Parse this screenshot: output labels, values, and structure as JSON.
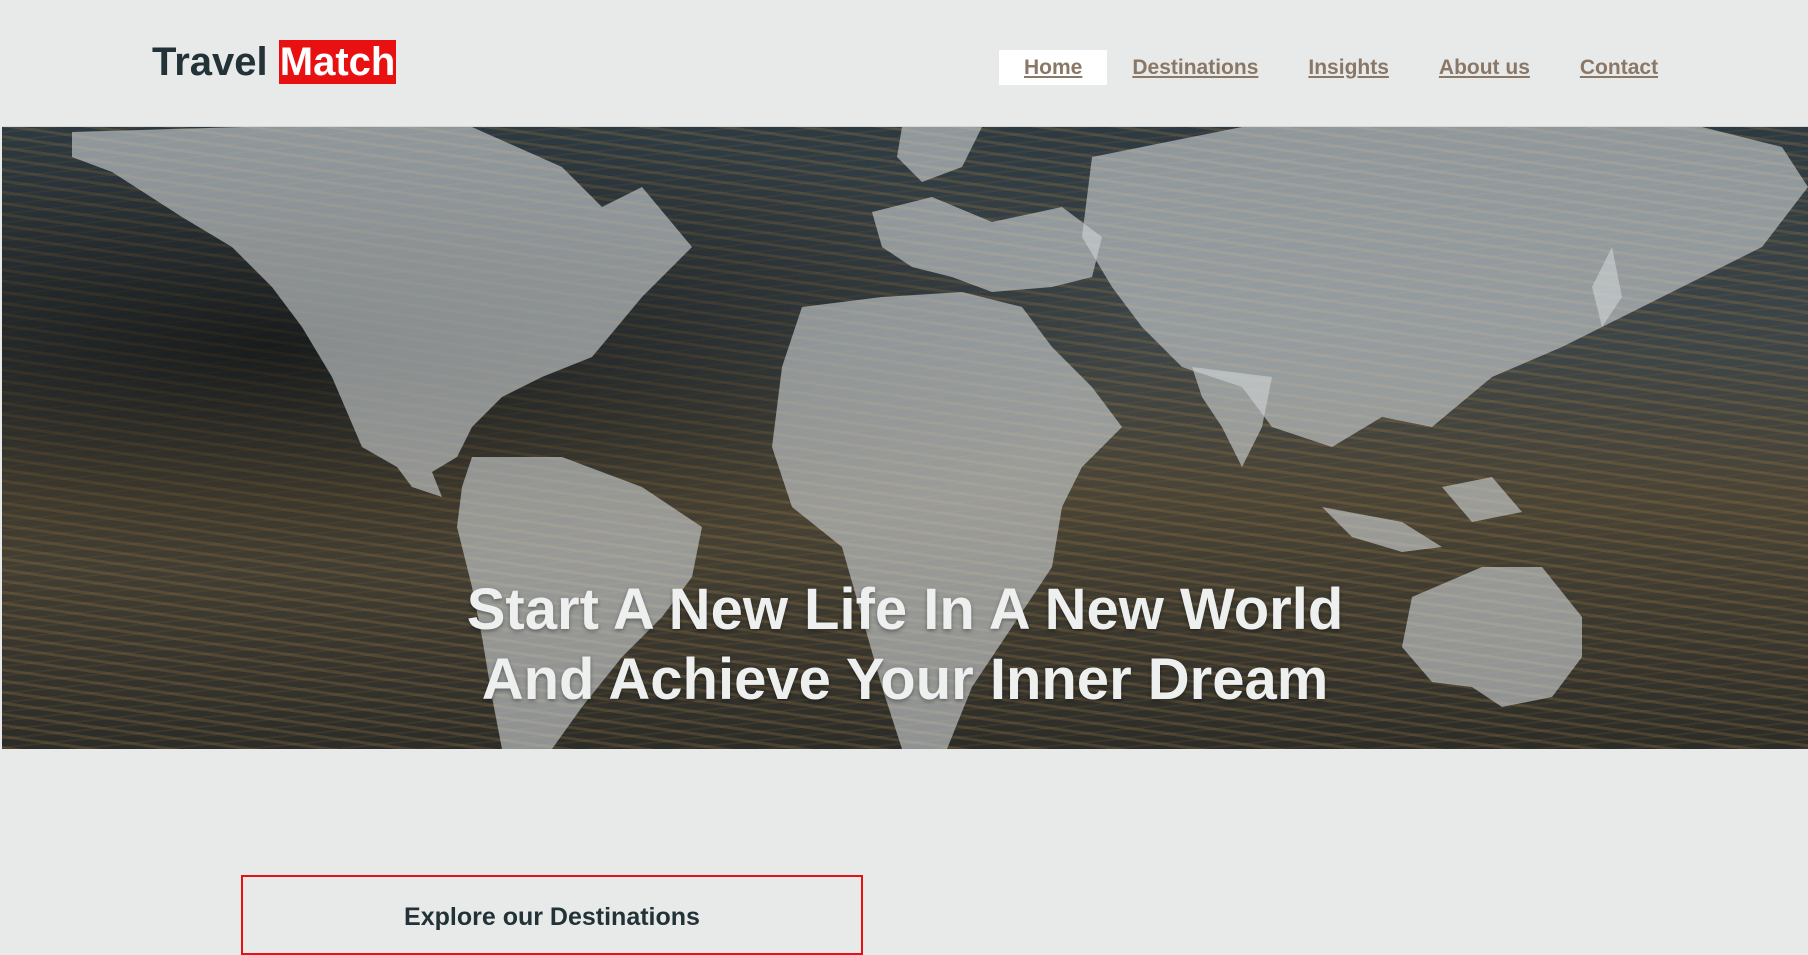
{
  "brand": {
    "name_part1": "Travel ",
    "name_part2": "Match"
  },
  "nav": {
    "items": [
      {
        "label": "Home",
        "active": true
      },
      {
        "label": "Destinations",
        "active": false
      },
      {
        "label": "Insights",
        "active": false
      },
      {
        "label": "About us",
        "active": false
      },
      {
        "label": "Contact",
        "active": false
      }
    ]
  },
  "hero": {
    "title_line1": "Start A New Life In A New World",
    "title_line2": "And Achieve Your Inner Dream",
    "background": "world-map-over-clouds"
  },
  "explore": {
    "label": "Explore our Destinations"
  },
  "colors": {
    "accent": "#e81010",
    "text_dark": "#223236",
    "nav_link": "#8a7766",
    "page_bg": "#e8eaea"
  }
}
